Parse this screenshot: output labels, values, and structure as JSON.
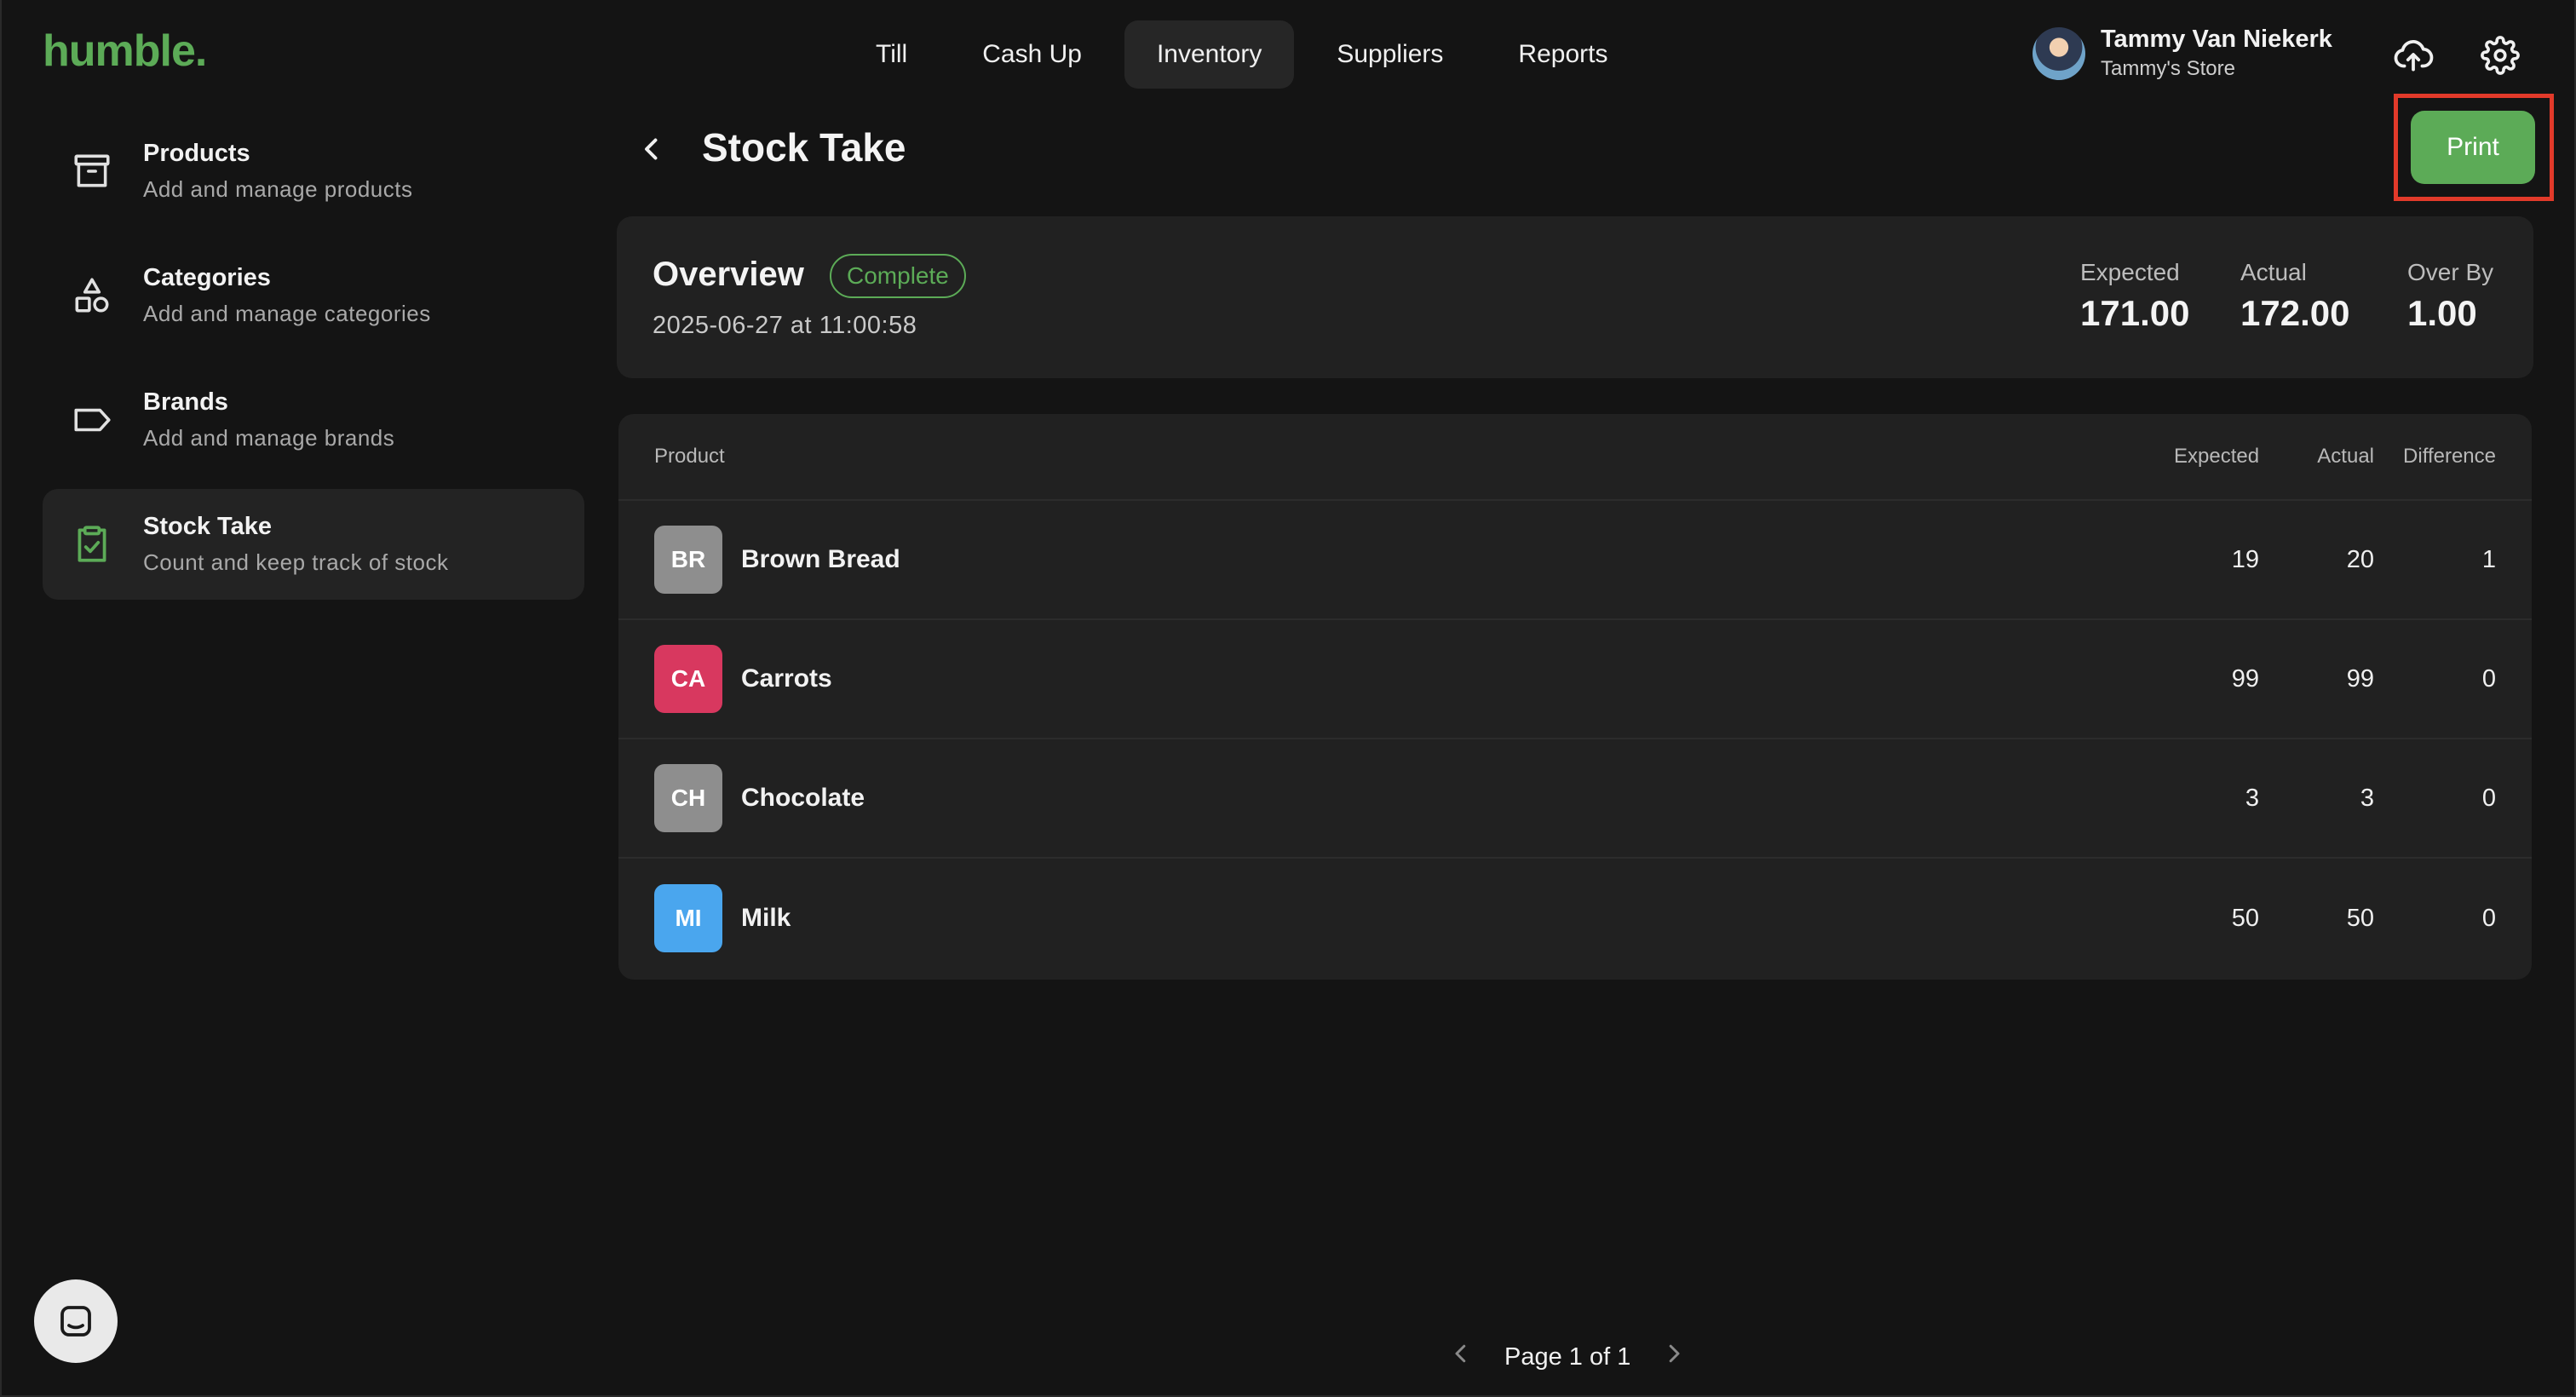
{
  "app": {
    "logo": "humble."
  },
  "nav": {
    "items": [
      {
        "label": "Till",
        "active": false
      },
      {
        "label": "Cash Up",
        "active": false
      },
      {
        "label": "Inventory",
        "active": true
      },
      {
        "label": "Suppliers",
        "active": false
      },
      {
        "label": "Reports",
        "active": false
      }
    ]
  },
  "user": {
    "name": "Tammy Van Niekerk",
    "store": "Tammy's Store"
  },
  "icons": {
    "cloud": "cloud-upload-icon",
    "settings": "gear-icon",
    "back": "chevron-left-icon",
    "chat": "chat-icon",
    "prev": "chevron-left-icon",
    "next": "chevron-right-icon"
  },
  "sidebar": {
    "items": [
      {
        "title": "Products",
        "subtitle": "Add and manage products",
        "icon": "archive-box-icon",
        "active": false
      },
      {
        "title": "Categories",
        "subtitle": "Add and manage categories",
        "icon": "shapes-icon",
        "active": false
      },
      {
        "title": "Brands",
        "subtitle": "Add and manage brands",
        "icon": "tag-icon",
        "active": false
      },
      {
        "title": "Stock Take",
        "subtitle": "Count and keep track of stock",
        "icon": "clipboard-check-icon",
        "active": true
      }
    ]
  },
  "page": {
    "title": "Stock Take",
    "print_label": "Print"
  },
  "overview": {
    "title": "Overview",
    "status": "Complete",
    "date": "2025-06-27 at 11:00:58",
    "stats": [
      {
        "label": "Expected",
        "value": "171.00"
      },
      {
        "label": "Actual",
        "value": "172.00"
      },
      {
        "label": "Over By",
        "value": "1.00"
      }
    ]
  },
  "table": {
    "headers": {
      "product": "Product",
      "expected": "Expected",
      "actual": "Actual",
      "difference": "Difference"
    },
    "rows": [
      {
        "initials": "BR",
        "name": "Brown Bread",
        "expected": "19",
        "actual": "20",
        "difference": "1",
        "color": "#8e8e8e"
      },
      {
        "initials": "CA",
        "name": "Carrots",
        "expected": "99",
        "actual": "99",
        "difference": "0",
        "color": "#d8385f"
      },
      {
        "initials": "CH",
        "name": "Chocolate",
        "expected": "3",
        "actual": "3",
        "difference": "0",
        "color": "#8e8e8e"
      },
      {
        "initials": "MI",
        "name": "Milk",
        "expected": "50",
        "actual": "50",
        "difference": "0",
        "color": "#4aa6ee"
      }
    ]
  },
  "pagination": {
    "label": "Page 1 of 1"
  },
  "colors": {
    "accent": "#5cab57",
    "highlight": "#e23a2a",
    "background": "#141414",
    "card": "#212121"
  }
}
